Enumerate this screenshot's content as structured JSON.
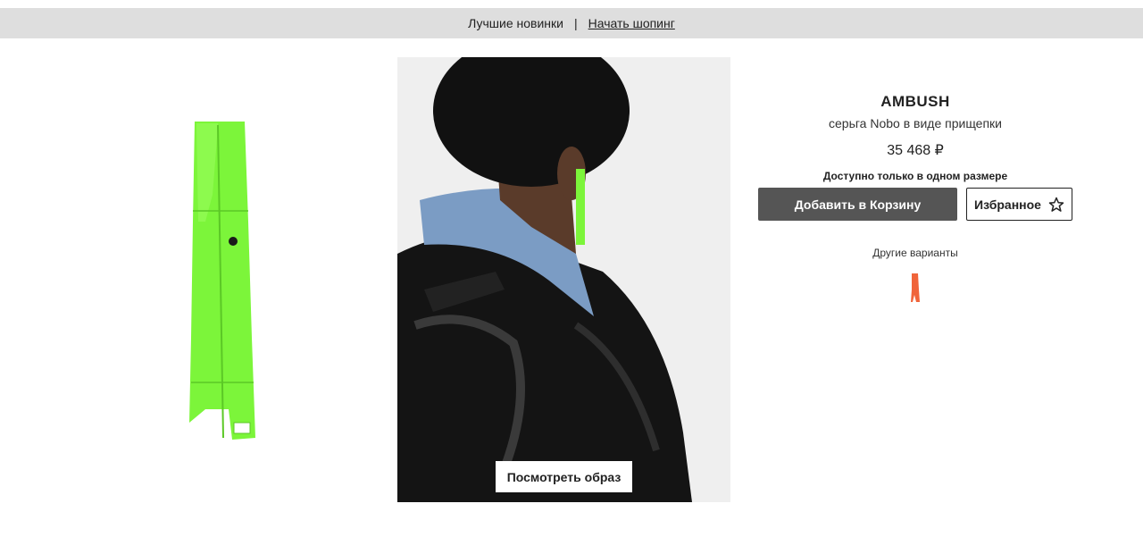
{
  "promo": {
    "left_text": "Лучшие новинки",
    "separator": "|",
    "link_text": "Начать шопинг"
  },
  "product": {
    "brand": "AMBUSH",
    "name": "серьга Nobo в виде прищепки",
    "price": "35 468 ₽",
    "size_note": "Доступно только в одном размере",
    "add_to_cart_label": "Добавить в Корзину",
    "wishlist_label": "Избранное",
    "other_variants_label": "Другие варианты",
    "view_look_label": "Посмотреть образ"
  },
  "colors": {
    "clothespin_green": "#7CF53A",
    "variant_orange": "#F0643A",
    "cart_button": "#555555",
    "promo_bar": "#DEDEDE"
  },
  "icons": {
    "wishlist": "star-outline-icon"
  }
}
